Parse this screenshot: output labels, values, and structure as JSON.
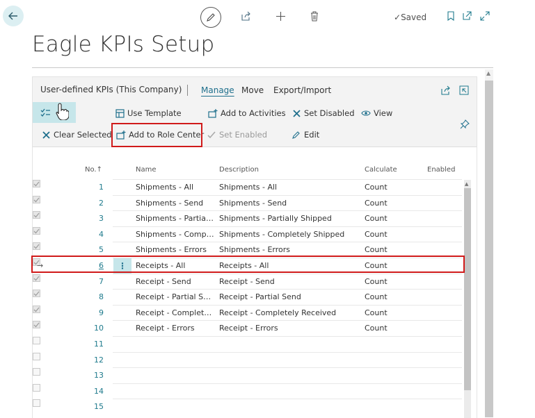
{
  "topbar": {
    "saved_label": "Saved"
  },
  "page": {
    "title": "Eagle KPIs Setup"
  },
  "part": {
    "title": "User-defined KPIs (This Company)",
    "tabs": [
      "Manage",
      "Move",
      "Export/Import"
    ]
  },
  "actions": {
    "use_template": "Use Template",
    "add_to_activities": "Add to Activities",
    "set_disabled": "Set Disabled",
    "view": "View",
    "clear_selected": "Clear Selected",
    "add_to_role_center": "Add to Role Center",
    "set_enabled": "Set Enabled",
    "edit": "Edit"
  },
  "grid": {
    "columns": {
      "no": "No.",
      "name": "Name",
      "description": "Description",
      "calculate": "Calculate",
      "enabled": "Enabled"
    },
    "sort_indicator": "↑",
    "selected_row": 6,
    "rows": [
      {
        "no": "1",
        "name": "Shipments - All",
        "description": "Shipments - All",
        "calculate": "Count",
        "enabled": true
      },
      {
        "no": "2",
        "name": "Shipments - Send",
        "description": "Shipments - Send",
        "calculate": "Count",
        "enabled": true
      },
      {
        "no": "3",
        "name": "Shipments - Partially Shipped",
        "description": "Shipments - Partially Shipped",
        "calculate": "Count",
        "enabled": true
      },
      {
        "no": "4",
        "name": "Shipments - Completely Shipped",
        "description": "Shipments - Completely Shipped",
        "calculate": "Count",
        "enabled": true
      },
      {
        "no": "5",
        "name": "Shipments - Errors",
        "description": "Shipments - Errors",
        "calculate": "Count",
        "enabled": true
      },
      {
        "no": "6",
        "name": "Receipts - All",
        "description": "Receipts - All",
        "calculate": "Count",
        "enabled": true
      },
      {
        "no": "7",
        "name": "Receipt - Send",
        "description": "Receipt - Send",
        "calculate": "Count",
        "enabled": true
      },
      {
        "no": "8",
        "name": "Receipt - Partial Send",
        "description": "Receipt - Partial Send",
        "calculate": "Count",
        "enabled": true
      },
      {
        "no": "9",
        "name": "Receipt - Completely Received",
        "description": "Receipt - Completely Received",
        "calculate": "Count",
        "enabled": true
      },
      {
        "no": "10",
        "name": "Receipt - Errors",
        "description": "Receipt - Errors",
        "calculate": "Count",
        "enabled": true
      },
      {
        "no": "11",
        "name": "",
        "description": "",
        "calculate": "",
        "enabled": false
      },
      {
        "no": "12",
        "name": "",
        "description": "",
        "calculate": "",
        "enabled": false
      },
      {
        "no": "13",
        "name": "",
        "description": "",
        "calculate": "",
        "enabled": false
      },
      {
        "no": "14",
        "name": "",
        "description": "",
        "calculate": "",
        "enabled": false
      },
      {
        "no": "15",
        "name": "",
        "description": "",
        "calculate": "",
        "enabled": false
      }
    ]
  },
  "colors": {
    "accent": "#1e7a8c",
    "highlight": "#d01a1a",
    "selection": "#c6e6ea"
  }
}
